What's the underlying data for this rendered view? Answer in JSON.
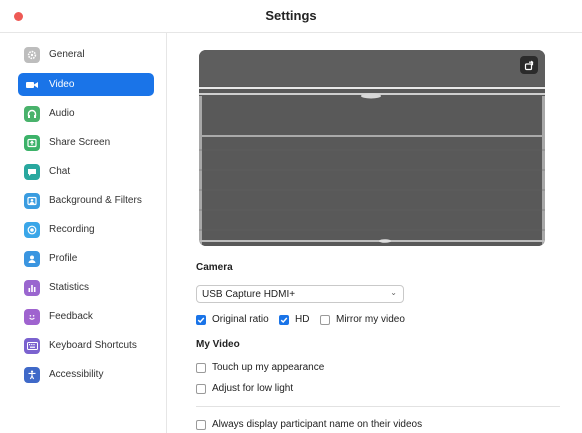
{
  "window": {
    "title": "Settings"
  },
  "sidebar": {
    "active_index": 1,
    "items": [
      {
        "label": "General",
        "icon": "gear-icon",
        "color": "#bdbdbd"
      },
      {
        "label": "Video",
        "icon": "video-camera-icon",
        "color": "#1a74e8"
      },
      {
        "label": "Audio",
        "icon": "headphones-icon",
        "color": "#49b26b"
      },
      {
        "label": "Share Screen",
        "icon": "share-screen-icon",
        "color": "#3cb269"
      },
      {
        "label": "Chat",
        "icon": "chat-icon",
        "color": "#29a89f"
      },
      {
        "label": "Background & Filters",
        "icon": "background-icon",
        "color": "#3a9ce0"
      },
      {
        "label": "Recording",
        "icon": "record-icon",
        "color": "#3aa6e8"
      },
      {
        "label": "Profile",
        "icon": "profile-icon",
        "color": "#3a95e0"
      },
      {
        "label": "Statistics",
        "icon": "bar-chart-icon",
        "color": "#9a66cf"
      },
      {
        "label": "Feedback",
        "icon": "smiley-icon",
        "color": "#9f63cf"
      },
      {
        "label": "Keyboard Shortcuts",
        "icon": "keyboard-icon",
        "color": "#7b62cf"
      },
      {
        "label": "Accessibility",
        "icon": "accessibility-icon",
        "color": "#3f69c8"
      }
    ]
  },
  "camera": {
    "heading": "Camera",
    "selected": "USB Capture HDMI+",
    "original_ratio": {
      "label": "Original ratio",
      "checked": true
    },
    "hd": {
      "label": "HD",
      "checked": true
    },
    "mirror": {
      "label": "Mirror my video",
      "checked": false
    }
  },
  "my_video": {
    "heading": "My Video",
    "touch_up": {
      "label": "Touch up my appearance",
      "checked": false
    },
    "low_light": {
      "label": "Adjust for low light",
      "checked": false
    }
  },
  "participant_name": {
    "label": "Always display participant name on their videos",
    "checked": false
  },
  "colors": {
    "accent": "#1a74e8",
    "close": "#ee5a55"
  }
}
